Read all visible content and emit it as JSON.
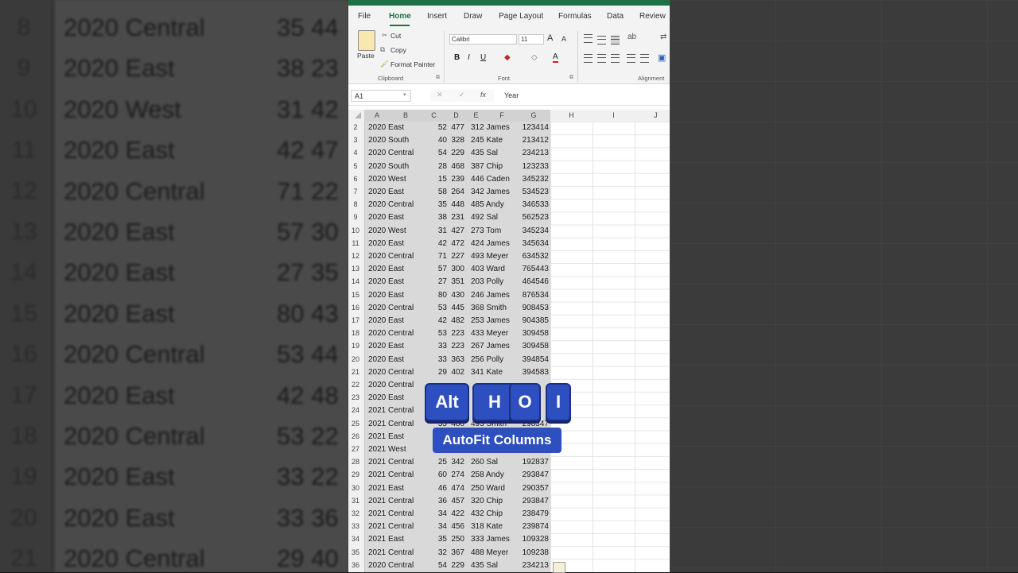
{
  "menu_tabs": [
    "File",
    "Home",
    "Insert",
    "Draw",
    "Page Layout",
    "Formulas",
    "Data",
    "Review"
  ],
  "ribbon": {
    "paste": "Paste",
    "cut": "Cut",
    "copy": "Copy",
    "format_painter": "Format Painter",
    "clipboard_group": "Clipboard",
    "font_name": "Calibri",
    "font_size": "11",
    "font_group": "Font",
    "bold": "B",
    "italic": "I",
    "underline": "U",
    "alignment_group": "Alignment"
  },
  "formula_bar": {
    "name_box": "A1",
    "fx": "fx",
    "content": "Year"
  },
  "column_headers": [
    "A",
    "B",
    "C",
    "D",
    "E",
    "F",
    "G",
    "H",
    "I",
    "J"
  ],
  "rows": [
    {
      "n": "2",
      "a": "2020 East",
      "c": "52",
      "d": "477",
      "e": "312 James",
      "g": "123414"
    },
    {
      "n": "3",
      "a": "2020 South",
      "c": "40",
      "d": "328",
      "e": "245 Kate",
      "g": "213412"
    },
    {
      "n": "4",
      "a": "2020 Central",
      "c": "54",
      "d": "229",
      "e": "435 Sal",
      "g": "234213"
    },
    {
      "n": "5",
      "a": "2020 South",
      "c": "28",
      "d": "468",
      "e": "387 Chip",
      "g": "123233"
    },
    {
      "n": "6",
      "a": "2020 West",
      "c": "15",
      "d": "239",
      "e": "446 Caden",
      "g": "345232"
    },
    {
      "n": "7",
      "a": "2020 East",
      "c": "58",
      "d": "264",
      "e": "342 James",
      "g": "534523"
    },
    {
      "n": "8",
      "a": "2020 Central",
      "c": "35",
      "d": "448",
      "e": "485 Andy",
      "g": "346533"
    },
    {
      "n": "9",
      "a": "2020 East",
      "c": "38",
      "d": "231",
      "e": "492 Sal",
      "g": "562523"
    },
    {
      "n": "10",
      "a": "2020 West",
      "c": "31",
      "d": "427",
      "e": "273 Tom",
      "g": "345234"
    },
    {
      "n": "11",
      "a": "2020 East",
      "c": "42",
      "d": "472",
      "e": "424 James",
      "g": "345634"
    },
    {
      "n": "12",
      "a": "2020 Central",
      "c": "71",
      "d": "227",
      "e": "493 Meyer",
      "g": "634532"
    },
    {
      "n": "13",
      "a": "2020 East",
      "c": "57",
      "d": "300",
      "e": "403 Ward",
      "g": "765443"
    },
    {
      "n": "14",
      "a": "2020 East",
      "c": "27",
      "d": "351",
      "e": "203 Polly",
      "g": "464546"
    },
    {
      "n": "15",
      "a": "2020 East",
      "c": "80",
      "d": "430",
      "e": "246 James",
      "g": "876534"
    },
    {
      "n": "16",
      "a": "2020 Central",
      "c": "53",
      "d": "445",
      "e": "368 Smith",
      "g": "908453"
    },
    {
      "n": "17",
      "a": "2020 East",
      "c": "42",
      "d": "482",
      "e": "253 James",
      "g": "904385"
    },
    {
      "n": "18",
      "a": "2020 Central",
      "c": "53",
      "d": "223",
      "e": "433 Meyer",
      "g": "309458"
    },
    {
      "n": "19",
      "a": "2020 East",
      "c": "33",
      "d": "223",
      "e": "267 James",
      "g": "309458"
    },
    {
      "n": "20",
      "a": "2020 East",
      "c": "33",
      "d": "363",
      "e": "256 Polly",
      "g": "394854"
    },
    {
      "n": "21",
      "a": "2020 Central",
      "c": "29",
      "d": "402",
      "e": "341 Kate",
      "g": "394583"
    },
    {
      "n": "22",
      "a": "2020 Central",
      "c": "",
      "d": "",
      "e": "",
      "g": ""
    },
    {
      "n": "23",
      "a": "2020 East",
      "c": "",
      "d": "",
      "e": "",
      "g": ""
    },
    {
      "n": "24",
      "a": "2021 Central",
      "c": "",
      "d": "",
      "e": "",
      "g": ""
    },
    {
      "n": "25",
      "a": "2021 Central",
      "c": "35",
      "d": "486",
      "e": "493 Smith",
      "g": "298347"
    },
    {
      "n": "26",
      "a": "2021 East",
      "c": "",
      "d": "",
      "e": "",
      "g": ""
    },
    {
      "n": "27",
      "a": "2021 West",
      "c": "",
      "d": "",
      "e": "",
      "g": ""
    },
    {
      "n": "28",
      "a": "2021 Central",
      "c": "25",
      "d": "342",
      "e": "260 Sal",
      "g": "192837"
    },
    {
      "n": "29",
      "a": "2021 Central",
      "c": "60",
      "d": "274",
      "e": "258 Andy",
      "g": "293847"
    },
    {
      "n": "30",
      "a": "2021 East",
      "c": "46",
      "d": "474",
      "e": "250 Ward",
      "g": "290357"
    },
    {
      "n": "31",
      "a": "2021 Central",
      "c": "36",
      "d": "457",
      "e": "320 Chip",
      "g": "293847"
    },
    {
      "n": "32",
      "a": "2021 Central",
      "c": "34",
      "d": "422",
      "e": "432 Chip",
      "g": "238479"
    },
    {
      "n": "33",
      "a": "2021 Central",
      "c": "34",
      "d": "456",
      "e": "318 Kate",
      "g": "239874"
    },
    {
      "n": "34",
      "a": "2021 East",
      "c": "35",
      "d": "250",
      "e": "333 James",
      "g": "109328"
    },
    {
      "n": "35",
      "a": "2021 Central",
      "c": "32",
      "d": "367",
      "e": "488 Meyer",
      "g": "109238"
    },
    {
      "n": "36",
      "a": "2020 Central",
      "c": "54",
      "d": "229",
      "e": "435 Sal",
      "g": "234213"
    }
  ],
  "background_rows": [
    {
      "n": "8",
      "t": "2020 Central",
      "v": "35 44"
    },
    {
      "n": "9",
      "t": "2020 East",
      "v": "38 23"
    },
    {
      "n": "10",
      "t": "2020 West",
      "v": "31 42"
    },
    {
      "n": "11",
      "t": "2020 East",
      "v": "42 47"
    },
    {
      "n": "12",
      "t": "2020 Central",
      "v": "71 22"
    },
    {
      "n": "13",
      "t": "2020 East",
      "v": "57 30"
    },
    {
      "n": "14",
      "t": "2020 East",
      "v": "27 35"
    },
    {
      "n": "15",
      "t": "2020 East",
      "v": "80 43"
    },
    {
      "n": "16",
      "t": "2020 Central",
      "v": "53 44"
    },
    {
      "n": "17",
      "t": "2020 East",
      "v": "42 48"
    },
    {
      "n": "18",
      "t": "2020 Central",
      "v": "53 22"
    },
    {
      "n": "19",
      "t": "2020 East",
      "v": "33 22"
    },
    {
      "n": "20",
      "t": "2020 East",
      "v": "33 36"
    },
    {
      "n": "21",
      "t": "2020 Central",
      "v": "29 40"
    }
  ],
  "overlay": {
    "keys": [
      "Alt",
      "H",
      "O",
      "I"
    ],
    "caption": "AutoFit Columns"
  },
  "colors": {
    "excel_green": "#1e7145",
    "key_blue": "#2e4fc0"
  }
}
